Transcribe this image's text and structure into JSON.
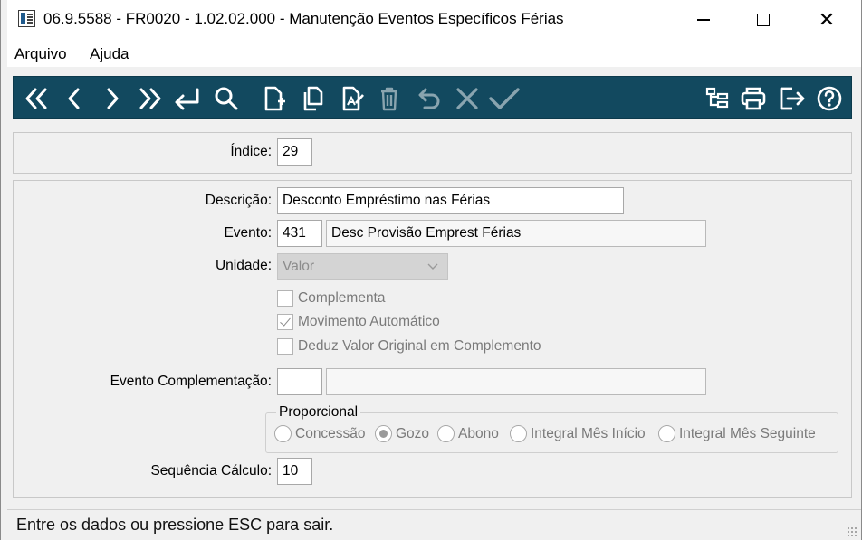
{
  "window": {
    "title": "06.9.5588 - FR0020 - 1.02.02.000 - Manutenção Eventos Específicos Férias",
    "close_glyph": "✕"
  },
  "menu": [
    {
      "label": "Arquivo"
    },
    {
      "label": "Ajuda"
    }
  ],
  "toolbar": {
    "buttons": [
      {
        "name": "first-record-icon",
        "enabled": true
      },
      {
        "name": "previous-record-icon",
        "enabled": true
      },
      {
        "name": "next-record-icon",
        "enabled": true
      },
      {
        "name": "last-record-icon",
        "enabled": true
      },
      {
        "name": "enter-icon",
        "enabled": true
      },
      {
        "name": "search-icon",
        "enabled": true
      },
      {
        "name": "new-document-icon",
        "enabled": true
      },
      {
        "name": "copy-document-icon",
        "enabled": true
      },
      {
        "name": "edit-document-icon",
        "enabled": true
      },
      {
        "name": "delete-icon",
        "enabled": false
      },
      {
        "name": "undo-icon",
        "enabled": false
      },
      {
        "name": "cancel-icon",
        "enabled": false
      },
      {
        "name": "confirm-icon",
        "enabled": false
      },
      {
        "name": "tree-icon",
        "enabled": true
      },
      {
        "name": "print-icon",
        "enabled": true
      },
      {
        "name": "exit-icon",
        "enabled": true
      },
      {
        "name": "help-icon",
        "enabled": true
      }
    ],
    "background": "#12495f"
  },
  "form": {
    "indice": {
      "label": "Índice:",
      "value": "29"
    },
    "descricao": {
      "label": "Descrição:",
      "value": "Desconto Empréstimo nas Férias"
    },
    "evento": {
      "label": "Evento:",
      "code": "431",
      "description": "Desc Provisão Emprest Férias"
    },
    "unidade": {
      "label": "Unidade:",
      "value": "Valor"
    },
    "checks": [
      {
        "label": "Complementa",
        "checked": false
      },
      {
        "label": "Movimento Automático",
        "checked": true
      },
      {
        "label": "Deduz Valor Original em Complemento",
        "checked": false
      }
    ],
    "evento_complementacao": {
      "label": "Evento Complementação:",
      "code": "",
      "description": ""
    },
    "proporcional": {
      "title": "Proporcional",
      "options": [
        {
          "label": "Concessão",
          "selected": false
        },
        {
          "label": "Gozo",
          "selected": true
        },
        {
          "label": "Abono",
          "selected": false
        },
        {
          "label": "Integral Mês Início",
          "selected": false
        },
        {
          "label": "Integral Mês Seguinte",
          "selected": false
        }
      ]
    },
    "sequencia": {
      "label": "Sequência Cálculo:",
      "value": "10"
    }
  },
  "status": {
    "text": "Entre os dados ou pressione ESC para sair."
  }
}
